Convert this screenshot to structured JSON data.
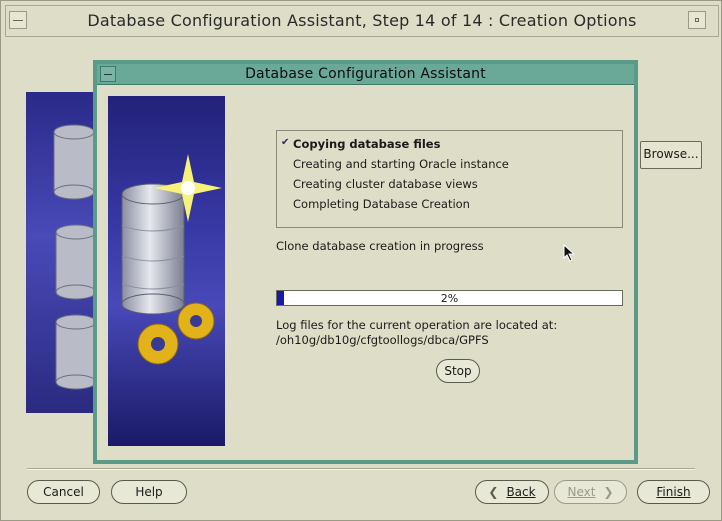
{
  "outer_window": {
    "title": "Database Configuration Assistant, Step 14 of 14 : Creation Options",
    "browse_label": "Browse..."
  },
  "dialog": {
    "title": "Database Configuration Assistant",
    "steps": [
      {
        "label": "Copying database files",
        "active": true
      },
      {
        "label": "Creating and starting Oracle instance",
        "active": false
      },
      {
        "label": "Creating cluster database views",
        "active": false
      },
      {
        "label": "Completing Database Creation",
        "active": false
      }
    ],
    "status": "Clone database creation in progress",
    "progress": {
      "percent_label": "2%",
      "value": 0.02
    },
    "log_intro": "Log files for the current operation are located at:",
    "log_path": "/oh10g/db10g/cfgtoollogs/dbca/GPFS",
    "stop_label": "Stop"
  },
  "footer": {
    "cancel_label": "Cancel",
    "help_label": "Help",
    "back_label": "Back",
    "next_label": "Next",
    "finish_label": "Finish"
  },
  "colors": {
    "window_bg": "#dedec8",
    "dialog_border": "#5a9a88",
    "titlebar": "#6aa898",
    "progress_fill": "#1a1aa8"
  },
  "icons": [
    "window-menu-icon",
    "maximize-icon",
    "check-icon",
    "back-arrow-icon",
    "next-arrow-icon",
    "mouse-cursor-icon"
  ]
}
